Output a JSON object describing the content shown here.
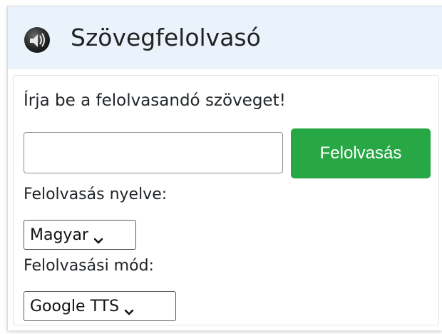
{
  "header": {
    "title": "Szövegfelolvasó",
    "logo_icon": "speaker-sound-icon",
    "background": "#eaf2fc"
  },
  "form": {
    "prompt": "Írja be a felolvasandó szöveget!",
    "text_input": {
      "value": "",
      "placeholder": ""
    },
    "read_button_label": "Felolvasás",
    "read_button_color": "#28a745",
    "language_label": "Felolvasás nyelve:",
    "language_selected": "Magyar",
    "mode_label": "Felolvasási mód:",
    "mode_selected": "Google TTS"
  }
}
